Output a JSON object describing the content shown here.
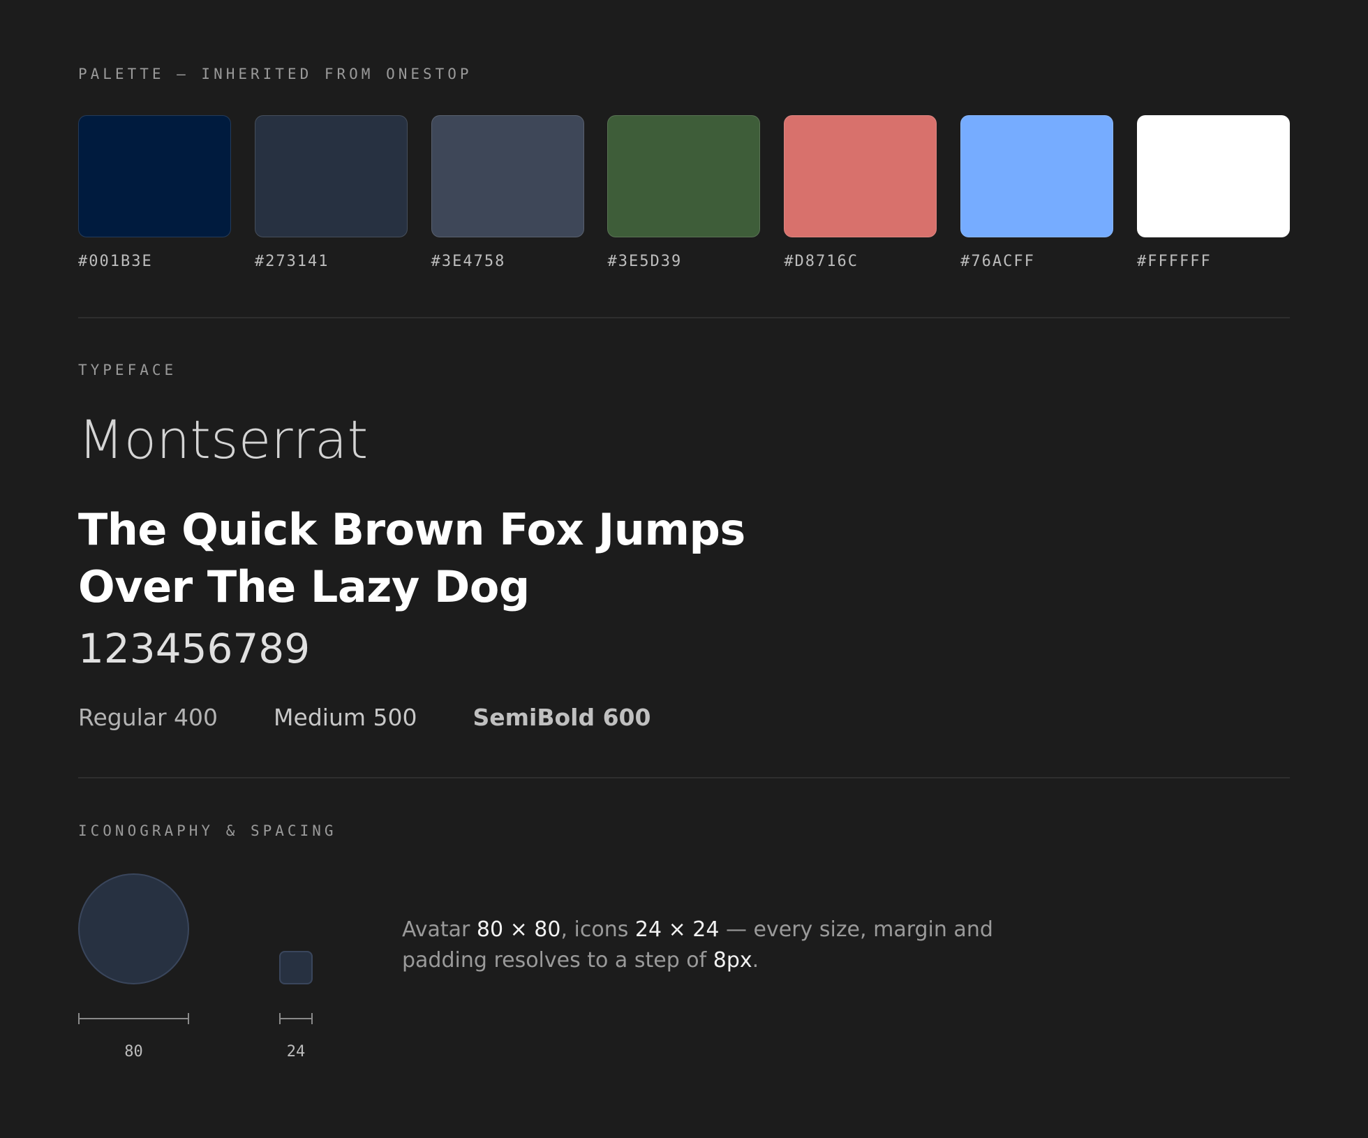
{
  "palette": {
    "label": "PALETTE — INHERITED FROM ONESTOP",
    "swatches": [
      {
        "hex": "#001B3E",
        "color": "#001B3E"
      },
      {
        "hex": "#273141",
        "color": "#273141"
      },
      {
        "hex": "#3E4758",
        "color": "#3E4758"
      },
      {
        "hex": "#3E5D39",
        "color": "#3E5D39"
      },
      {
        "hex": "#D8716C",
        "color": "#D8716C"
      },
      {
        "hex": "#76ACFF",
        "color": "#76ACFF"
      },
      {
        "hex": "#FFFFFF",
        "color": "#FFFFFF"
      }
    ]
  },
  "typeface": {
    "label": "TYPEFACE",
    "font_name": "Montserrat",
    "pangram": "The Quick Brown Fox Jumps Over The Lazy Dog",
    "digits": "123456789",
    "weights": {
      "regular": "Regular 400",
      "medium": "Medium 500",
      "semibold": "SemiBold 600"
    }
  },
  "iconography": {
    "label": "ICONOGRAPHY & SPACING",
    "avatar_size": "80",
    "icon_size": "24",
    "description": {
      "t1": "Avatar ",
      "h1": "80 × 80",
      "t2": ", icons ",
      "h2": "24 × 24",
      "t3": " — every size, margin and padding resolves to a step of ",
      "h3": "8px",
      "t4": "."
    }
  }
}
